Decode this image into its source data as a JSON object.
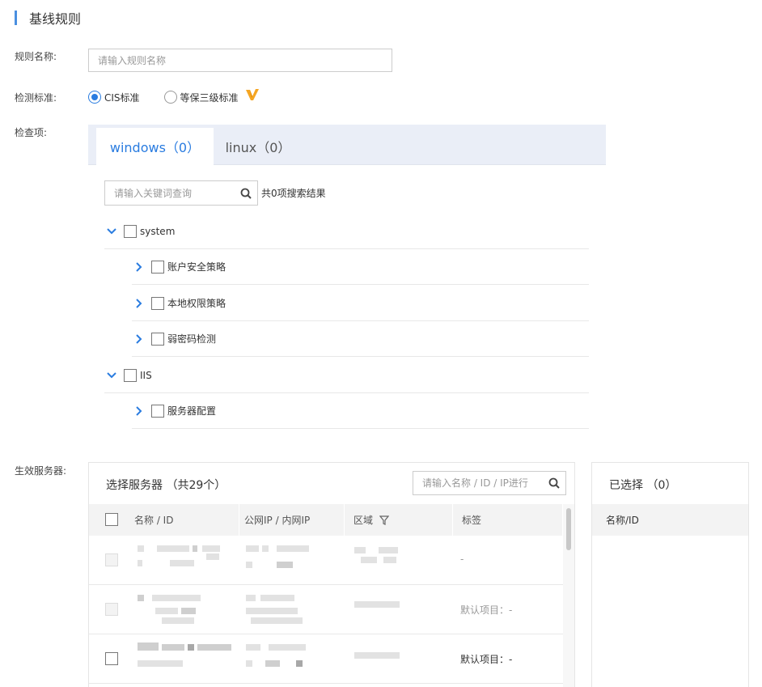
{
  "page": {
    "title": "基线规则"
  },
  "form": {
    "rule_name_label": "规则名称:",
    "rule_name_placeholder": "请输入规则名称",
    "standard_label": "检测标准:",
    "standard_options": [
      {
        "label": "CIS标准",
        "checked": true
      },
      {
        "label": "等保三级标准",
        "checked": false
      }
    ],
    "check_items_label": "检查项:",
    "servers_label": "生效服务器:"
  },
  "tabs": [
    {
      "label": "windows（0）",
      "active": true
    },
    {
      "label": "linux（0）",
      "active": false
    }
  ],
  "tree_search": {
    "placeholder": "请输入关键词查询",
    "result_text": "共0项搜索结果"
  },
  "tree": [
    {
      "label": "system",
      "level": 0,
      "expanded": true
    },
    {
      "label": "账户安全策略",
      "level": 1,
      "expanded": false
    },
    {
      "label": "本地权限策略",
      "level": 1,
      "expanded": false
    },
    {
      "label": "弱密码检测",
      "level": 1,
      "expanded": false
    },
    {
      "label": "IIS",
      "level": 0,
      "expanded": true
    },
    {
      "label": "服务器配置",
      "level": 1,
      "expanded": false
    }
  ],
  "server_panel": {
    "title": "选择服务器 （共29个）",
    "search_placeholder": "请输入名称 / ID / IP进行",
    "columns": [
      "名称 / ID",
      "公网IP / 内网IP",
      "区域",
      "标签"
    ],
    "rows": [
      {
        "tag": "-",
        "disabled": true
      },
      {
        "tag": "默认项目：-",
        "disabled": true
      },
      {
        "tag": "默认项目：-",
        "disabled": false
      }
    ]
  },
  "selected_panel": {
    "title": "已选择 （0）",
    "column": "名称/ID"
  },
  "colors": {
    "accent": "#2a7ce0",
    "tab_bg": "#eaeef7",
    "v_badge": "#f5a623"
  }
}
